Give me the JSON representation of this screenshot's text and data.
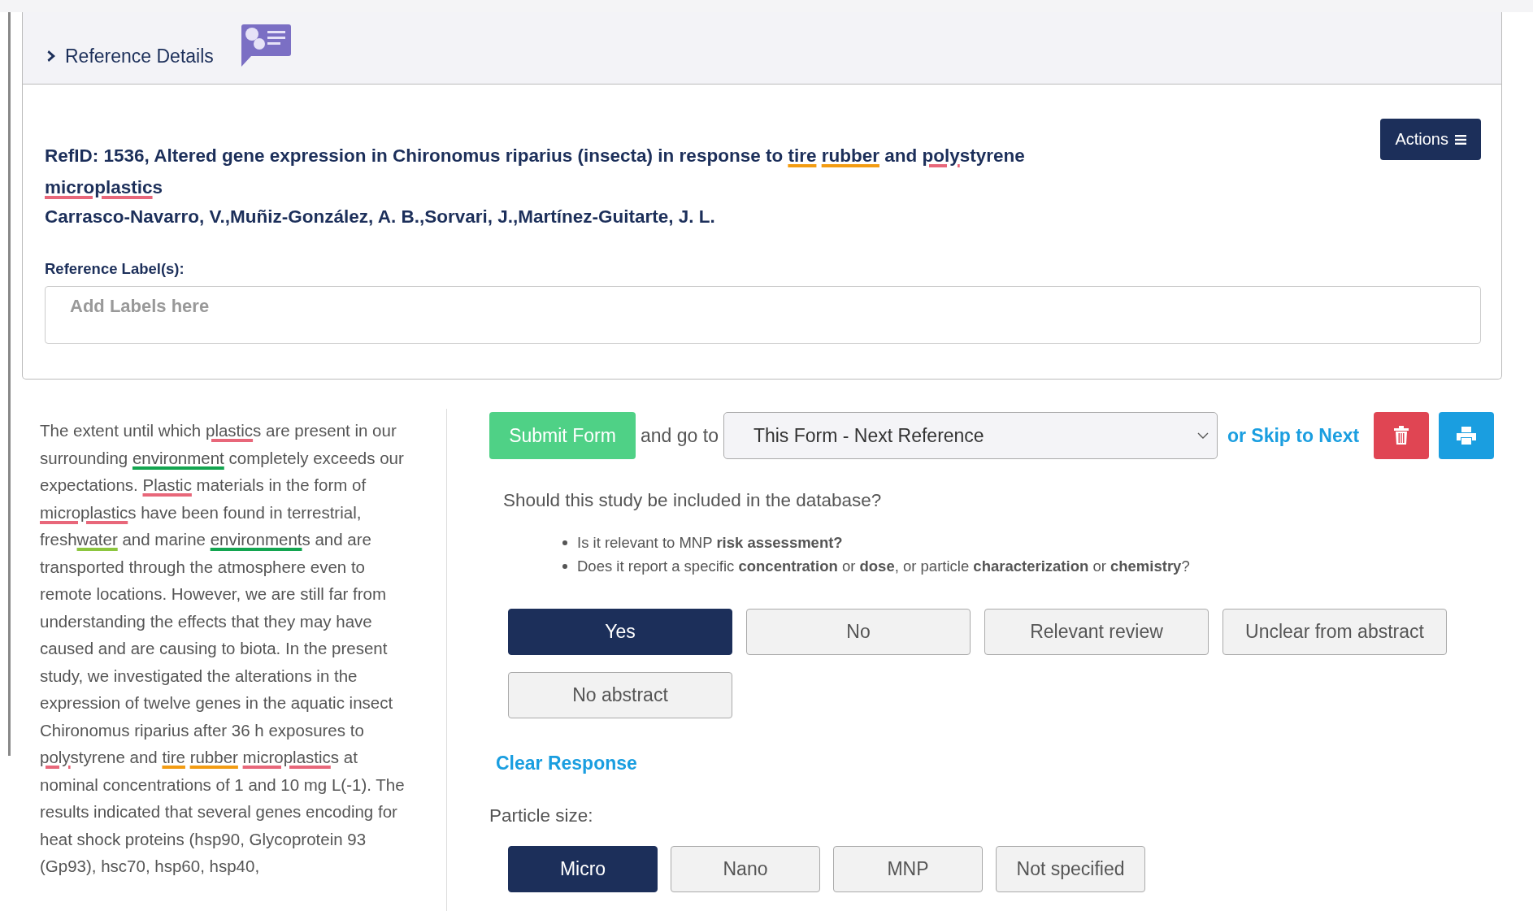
{
  "header": {
    "title": "Reference Details",
    "expanded": false
  },
  "reference": {
    "title": [
      {
        "text": "RefID: 1536, Altered gene expression in Chironomus riparius (insecta) in response to "
      },
      {
        "text": "tire",
        "color": "#f39c12"
      },
      {
        "text": " rubber",
        "color": "#f39c12"
      },
      {
        "text": " and "
      },
      {
        "text": "poly",
        "color": "#e8677a"
      },
      {
        "text": "styrene "
      },
      {
        "text": "microplastic",
        "color": "#e8677a"
      },
      {
        "text": "s"
      }
    ],
    "authors": "Carrasco-Navarro, V.,Muñiz-González, A. B.,Sorvari, J.,Martínez-Guitarte, J. L.",
    "actions_button": "Actions",
    "labels_label": "Reference Label(s):",
    "labels_placeholder": "Add Labels here"
  },
  "abstract": [
    {
      "text": "The extent until which "
    },
    {
      "text": "plastic",
      "color": "#e8677a"
    },
    {
      "text": "s are present in our surrounding "
    },
    {
      "text": "environment",
      "color": "#13a550"
    },
    {
      "text": " completely exceeds our expectations. "
    },
    {
      "text": "Plastic",
      "color": "#e8677a"
    },
    {
      "text": " materials in the form of "
    },
    {
      "text": "microplastic",
      "color": "#e8677a"
    },
    {
      "text": "s have been found in terrestrial, fresh"
    },
    {
      "text": "water",
      "color": "#8cc63f"
    },
    {
      "text": " and marine "
    },
    {
      "text": "environment",
      "color": "#13a550"
    },
    {
      "text": "s and are transported through the atmosphere even to remote locations. However, we are still far from understanding the effects that they may have caused and are causing to biota. In the present study, we investigated the alterations in the expression of twelve genes in the aquatic insect Chironomus riparius after 36 h exposures to "
    },
    {
      "text": "poly",
      "color": "#e8677a"
    },
    {
      "text": "styrene and "
    },
    {
      "text": "tire",
      "color": "#f39c12"
    },
    {
      "text": " rubber",
      "color": "#f39c12"
    },
    {
      "text": " microplastic",
      "color": "#e8677a"
    },
    {
      "text": "s at nominal concentrations of 1 and 10 mg L(-1). The results indicated that several genes encoding for heat shock proteins (hsp90, Glycoprotein 93 (Gp93), hsc70, hsp60, hsp40,"
    }
  ],
  "form": {
    "submit_button": "Submit Form",
    "goto_label": "and go to",
    "goto_value": "This Form - Next Reference",
    "skip_link": "or Skip to Next",
    "question": "Should this study be included in the database?",
    "hints": [
      "Is it relevant to MNP **risk assessment?**",
      "Does it report a specific **concentration** or **dose**, or particle **characterization** or **chemistry**?"
    ],
    "answers": [
      {
        "label": "Yes",
        "selected": true
      },
      {
        "label": "No",
        "selected": false
      },
      {
        "label": "Relevant review",
        "selected": false
      },
      {
        "label": "Unclear from abstract",
        "selected": false
      },
      {
        "label": "No abstract",
        "selected": false
      }
    ],
    "clear_link": "Clear Response",
    "particle_label": "Particle size:",
    "particle_sizes": [
      {
        "label": "Micro",
        "selected": true
      },
      {
        "label": "Nano",
        "selected": false
      },
      {
        "label": "MNP",
        "selected": false
      },
      {
        "label": "Not specified",
        "selected": false
      }
    ]
  }
}
